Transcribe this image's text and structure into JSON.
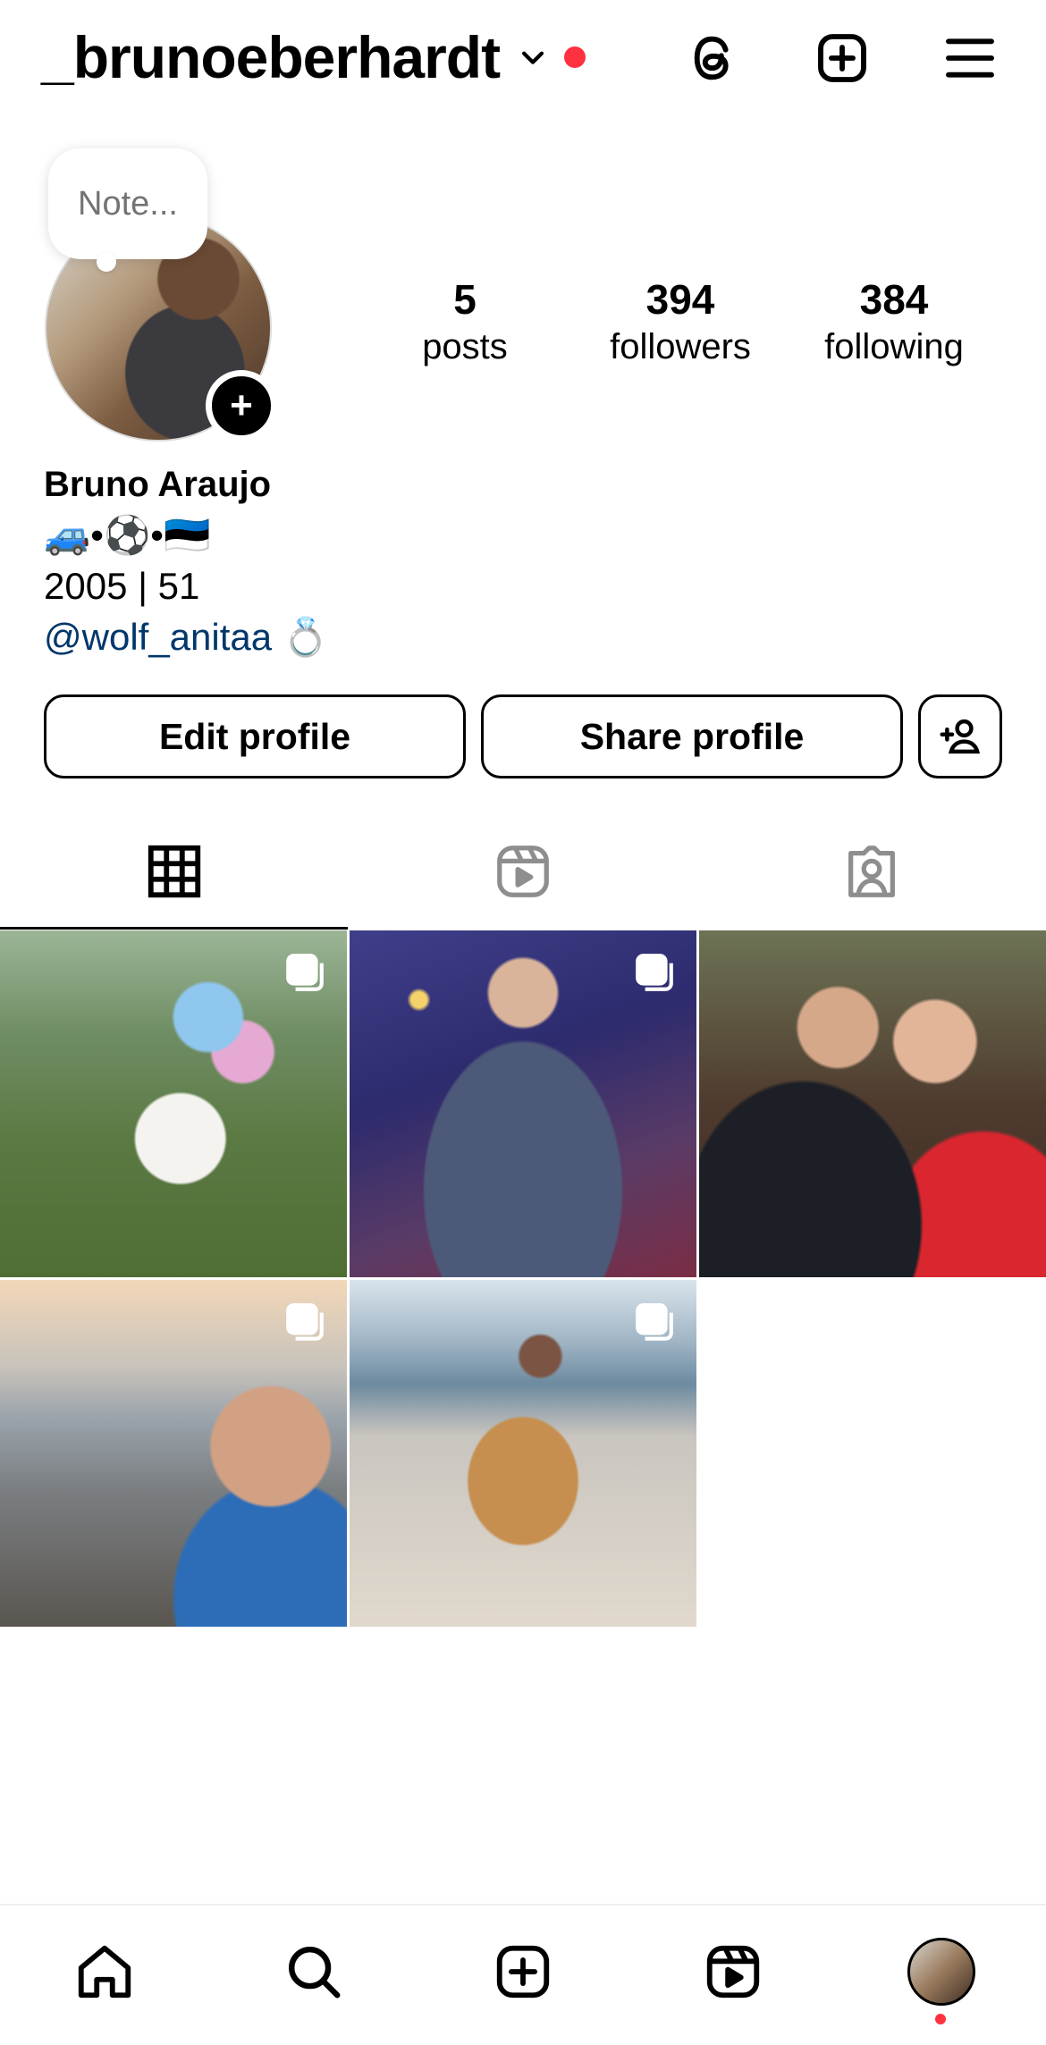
{
  "header": {
    "username": "_brunoeberhardt",
    "icons": [
      "chevron-down-icon",
      "threads-icon",
      "create-icon",
      "menu-icon"
    ]
  },
  "note": {
    "placeholder": "Note..."
  },
  "stats": {
    "posts": {
      "value": "5",
      "label": "posts"
    },
    "followers": {
      "value": "394",
      "label": "followers"
    },
    "following": {
      "value": "384",
      "label": "following"
    }
  },
  "bio": {
    "name": "Bruno Araujo",
    "line1": "🚙•⚽️•🇪🇪",
    "line2": "2005 | 51",
    "mention": "@wolf_anitaa",
    "mention_emoji": "💍"
  },
  "buttons": {
    "edit": "Edit profile",
    "share": "Share profile"
  },
  "tabs": [
    "grid-icon",
    "reels-icon",
    "tagged-icon"
  ],
  "posts": [
    {
      "id": 1,
      "multi": true
    },
    {
      "id": 2,
      "multi": true
    },
    {
      "id": 3,
      "multi": false
    },
    {
      "id": 4,
      "multi": true
    },
    {
      "id": 5,
      "multi": true
    }
  ],
  "colors": {
    "accent_dot": "#ff3040",
    "link": "#00376b",
    "muted": "#737373"
  },
  "bottom_nav": [
    "home-icon",
    "search-icon",
    "create-icon",
    "reels-icon",
    "profile-avatar"
  ]
}
